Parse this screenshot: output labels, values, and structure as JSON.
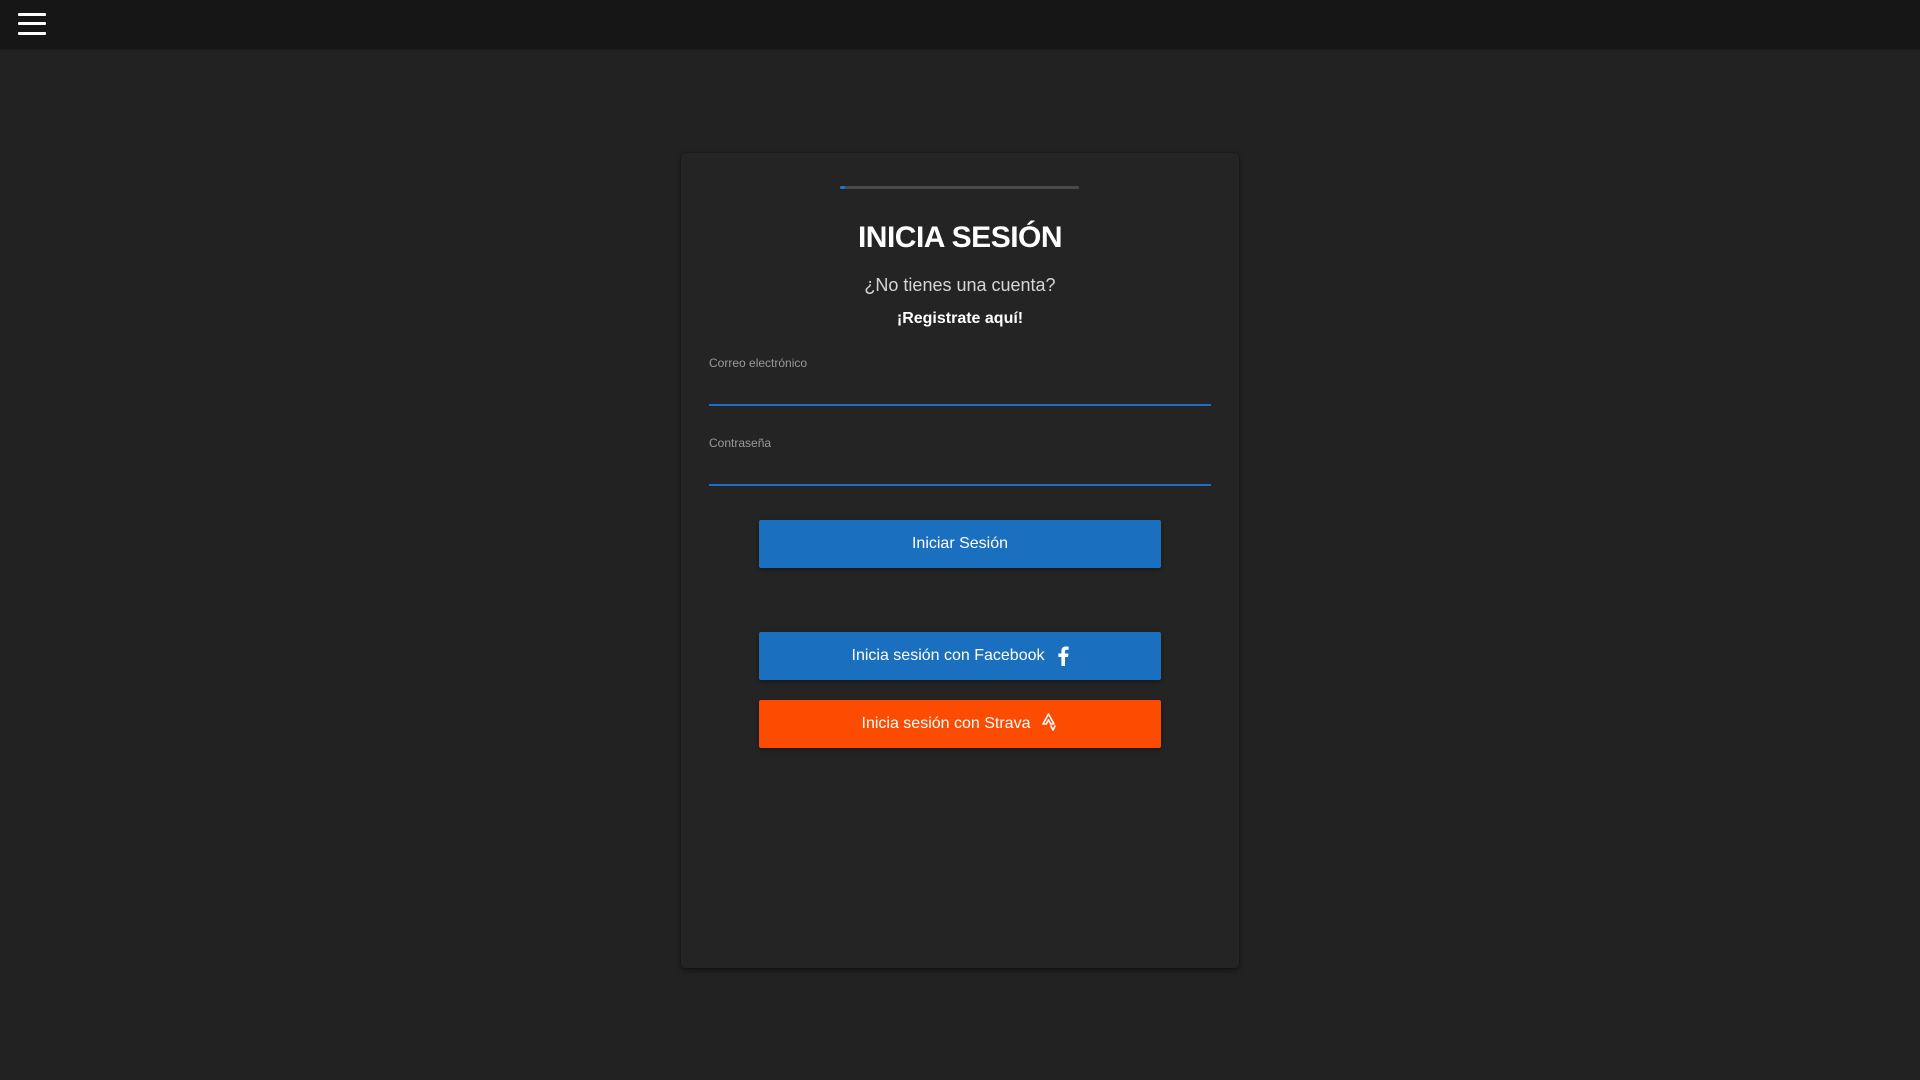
{
  "header": {
    "menu_icon": "hamburger-menu-icon"
  },
  "login": {
    "progress_percent": 2,
    "progress_color": "#1a76c9",
    "title": "INICIA SESIÓN",
    "no_account_text": "¿No tienes una cuenta?",
    "register_link": "¡Registrate aquí!",
    "email": {
      "label": "Correo electrónico",
      "value": ""
    },
    "password": {
      "label": "Contraseña",
      "value": ""
    },
    "submit_label": "Iniciar Sesión",
    "facebook_label": "Inicia sesión con Facebook",
    "facebook_icon": "facebook-f-icon",
    "strava_label": "Inicia sesión con Strava",
    "strava_icon": "strava-logo-icon"
  },
  "colors": {
    "background": "#222222",
    "topbar": "#161616",
    "card": "#242424",
    "primary_blue": "#1a6fbf",
    "strava_orange": "#fc4c02"
  }
}
